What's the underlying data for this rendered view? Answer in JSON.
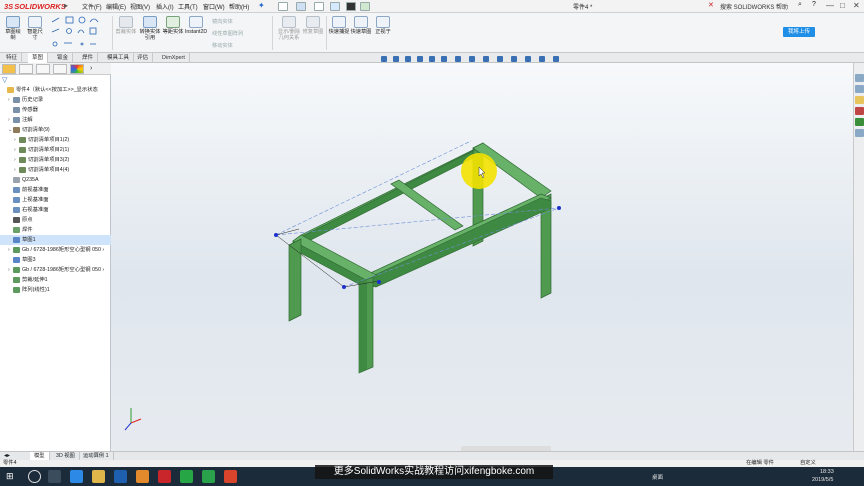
{
  "app": {
    "logo_ds": "3S",
    "logo_text": "SOLIDWORKS",
    "document_title": "零件4 *",
    "search_hint": "搜索 SOLIDWORKS 帮助"
  },
  "menus": [
    "文件(F)",
    "编辑(E)",
    "视图(V)",
    "插入(I)",
    "工具(T)",
    "窗口(W)",
    "帮助(H)"
  ],
  "window_buttons": [
    "—",
    "□",
    "✕"
  ],
  "ribbon": {
    "sketch_btn": "草图绘制",
    "smart_dim": "智能尺寸",
    "trim": "剪裁实体",
    "convert": "转换实体引用",
    "offset": "等距实体",
    "instant2d": "Instant2D",
    "mirror": "镜向实体",
    "linear_pattern": "线性草图阵列",
    "move": "移动实体",
    "display_delete": "显示/删除几何关系",
    "repair": "修复草图",
    "quick_snap": "快速捕捉",
    "rapid_sketch": "快速草图",
    "normal_to": "正视于",
    "upload": "我将上传"
  },
  "tabs": [
    "特征",
    "草图",
    "钣金",
    "焊件",
    "模具工具",
    "评估",
    "DimXpert"
  ],
  "active_tab": 1,
  "feature_tree": [
    {
      "label": "零件4（默认<<按加工>>_显示状态",
      "indent": 0,
      "icon": "part",
      "arrow": ""
    },
    {
      "label": "历史记录",
      "indent": 1,
      "icon": "history",
      "arrow": "›"
    },
    {
      "label": "传感器",
      "indent": 1,
      "icon": "sensor",
      "arrow": ""
    },
    {
      "label": "注解",
      "indent": 1,
      "icon": "annotation",
      "arrow": "›"
    },
    {
      "label": "切割清单(9)",
      "indent": 1,
      "icon": "cutlist",
      "arrow": "⌄"
    },
    {
      "label": "切割清单项目1(2)",
      "indent": 2,
      "icon": "cutitem",
      "arrow": "›"
    },
    {
      "label": "切割清单项目2(1)",
      "indent": 2,
      "icon": "cutitem",
      "arrow": "›"
    },
    {
      "label": "切割清单项目3(2)",
      "indent": 2,
      "icon": "cutitem",
      "arrow": "›"
    },
    {
      "label": "切割清单项目4(4)",
      "indent": 2,
      "icon": "cutitem",
      "arrow": "›"
    },
    {
      "label": "Q235A",
      "indent": 1,
      "icon": "material",
      "arrow": ""
    },
    {
      "label": "前视基准面",
      "indent": 1,
      "icon": "plane",
      "arrow": ""
    },
    {
      "label": "上视基准面",
      "indent": 1,
      "icon": "plane",
      "arrow": ""
    },
    {
      "label": "右视基准面",
      "indent": 1,
      "icon": "plane",
      "arrow": ""
    },
    {
      "label": "原点",
      "indent": 1,
      "icon": "origin",
      "arrow": ""
    },
    {
      "label": "焊件",
      "indent": 1,
      "icon": "weldment",
      "arrow": ""
    },
    {
      "label": "草图1",
      "indent": 1,
      "icon": "sketch",
      "arrow": "",
      "selected": true
    },
    {
      "label": "Gb / 6728-1986矩形空心型钢 050 ›",
      "indent": 1,
      "icon": "structure",
      "arrow": "›"
    },
    {
      "label": "草图3",
      "indent": 1,
      "icon": "sketch",
      "arrow": ""
    },
    {
      "label": "Gb / 6728-1986矩形空心型钢 050 ›",
      "indent": 1,
      "icon": "structure",
      "arrow": "›"
    },
    {
      "label": "剪裁/延伸1",
      "indent": 1,
      "icon": "trim",
      "arrow": ""
    },
    {
      "label": "阵列(线性)1",
      "indent": 1,
      "icon": "pattern",
      "arrow": ""
    }
  ],
  "model_tabs": [
    "模型",
    "3D 视图",
    "运动算例 1"
  ],
  "status": {
    "left": "零件4",
    "editing": "在编辑 零件",
    "custom": "自定义",
    "taskbar_input": "桌面",
    "time": "18:33",
    "date": "2019/5/5"
  },
  "banner": "更多SolidWorks实战教程访问xifengboke.com",
  "colors": {
    "frame": "#4f9a4f",
    "frame_dark": "#2f6a33",
    "accent": "#1e8ee6",
    "cursor_halo": "#f3e200"
  }
}
